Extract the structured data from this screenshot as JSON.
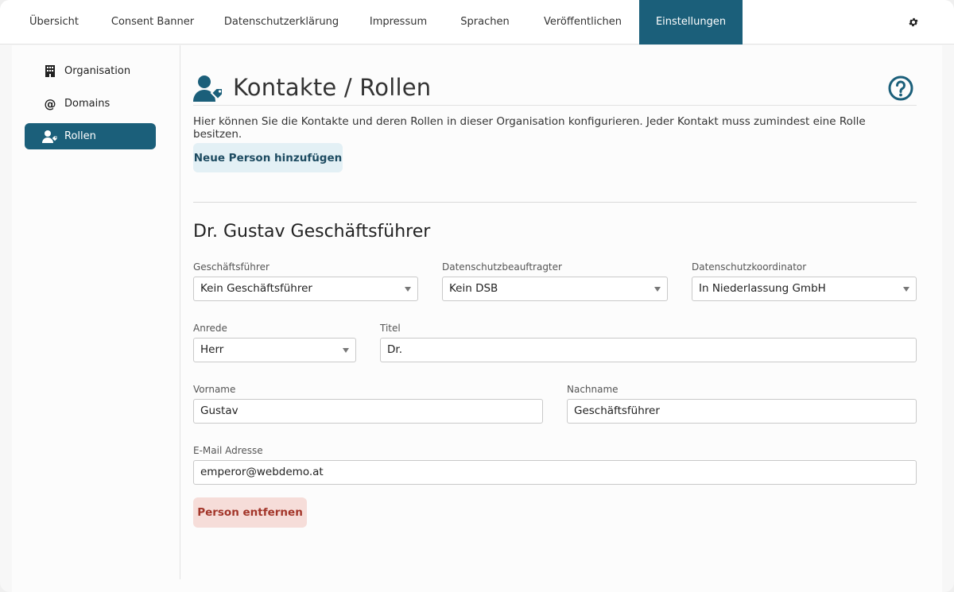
{
  "nav": {
    "tabs": [
      {
        "label": "Übersicht"
      },
      {
        "label": "Consent Banner"
      },
      {
        "label": "Datenschutzerklärung"
      },
      {
        "label": "Impressum"
      },
      {
        "label": "Sprachen"
      },
      {
        "label": "Veröffentlichen"
      },
      {
        "label": "Einstellungen"
      }
    ],
    "active_tab": "Einstellungen",
    "settings_icon": "gear-icon"
  },
  "sidebar": {
    "items": [
      {
        "label": "Organisation",
        "icon": "building-icon"
      },
      {
        "label": "Domains",
        "icon": "at-icon"
      },
      {
        "label": "Rollen",
        "icon": "user-tag-icon"
      }
    ],
    "active_item": "Rollen"
  },
  "page": {
    "title": "Kontakte / Rollen",
    "description": "Hier können Sie die Kontakte und deren Rollen in dieser Organisation konfigurieren. Jeder Kontakt muss zumindest eine Rolle besitzen.",
    "add_button": "Neue Person hinzufügen"
  },
  "person": {
    "name": "Dr. Gustav Geschäftsführer",
    "fields": {
      "geschaeftsfuehrer": {
        "label": "Geschäftsführer",
        "value": "Kein Geschäftsführer"
      },
      "dsb": {
        "label": "Datenschutzbeauftragter",
        "value": "Kein DSB"
      },
      "koordinator": {
        "label": "Datenschutzkoordinator",
        "value": "In Niederlassung GmbH"
      },
      "anrede": {
        "label": "Anrede",
        "value": "Herr"
      },
      "titel": {
        "label": "Titel",
        "value": "Dr."
      },
      "vorname": {
        "label": "Vorname",
        "value": "Gustav"
      },
      "nachname": {
        "label": "Nachname",
        "value": "Geschäftsführer"
      },
      "email": {
        "label": "E-Mail Adresse",
        "value": "emperor@webdemo.at"
      }
    },
    "remove_button": "Person entfernen"
  },
  "colors": {
    "accent": "#1b5f7a",
    "add_button_bg": "#e3f0f5",
    "remove_button_bg": "#f6ddd9",
    "remove_button_text": "#a3362a"
  }
}
